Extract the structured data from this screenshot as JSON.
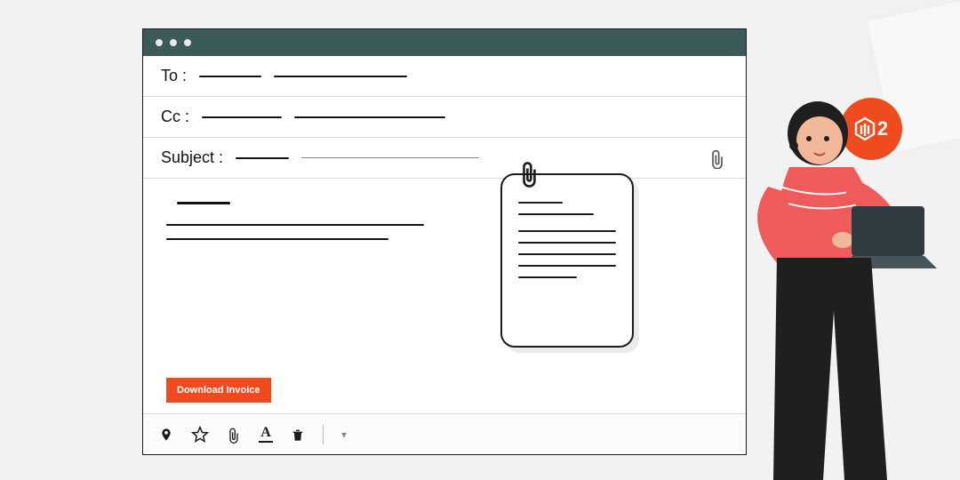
{
  "fields": {
    "to_label": "To :",
    "cc_label": "Cc :",
    "subject_label": "Subject :"
  },
  "actions": {
    "download_invoice": "Download Invoice"
  },
  "badge": {
    "text": "2"
  },
  "toolbar": {
    "pin": "pin-icon",
    "star": "star-icon",
    "attach": "attachment-icon",
    "font": "font-icon",
    "trash": "trash-icon",
    "more": "more-chevron"
  }
}
